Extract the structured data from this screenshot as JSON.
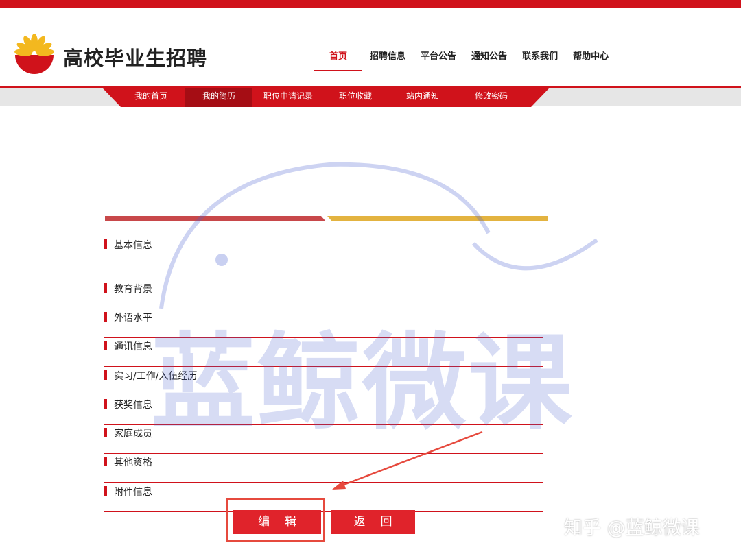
{
  "header": {
    "site_title": "高校毕业生招聘"
  },
  "top_nav": [
    "首页",
    "招聘信息",
    "平台公告",
    "通知公告",
    "联系我们",
    "帮助中心"
  ],
  "top_nav_active": 0,
  "sub_nav": [
    "我的首页",
    "我的简历",
    "职位申请记录",
    "职位收藏",
    "站内通知",
    "修改密码"
  ],
  "sub_nav_active": 1,
  "resume_sections": [
    "基本信息",
    "教育背景",
    "外语水平",
    "通讯信息",
    "实习/工作/入伍经历",
    "获奖信息",
    "家庭成员",
    "其他资格",
    "附件信息"
  ],
  "buttons": {
    "edit": "编辑",
    "back": "返回"
  },
  "watermark": {
    "text": "蓝鲸微课",
    "corner_text": "知乎 @蓝鲸微课"
  },
  "colors": {
    "brand_red": "#d0121b",
    "stripe_red": "#c8484a",
    "stripe_gold": "#e3b340",
    "watermark_blue": "#4c62d0"
  }
}
